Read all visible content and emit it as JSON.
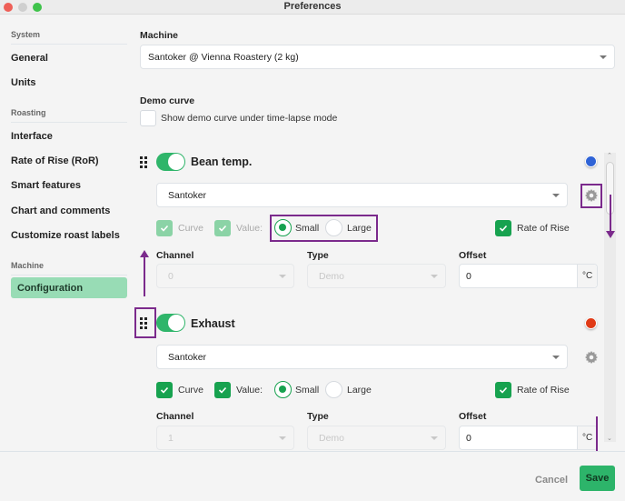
{
  "window": {
    "title": "Preferences"
  },
  "sidebar": {
    "sections": [
      {
        "label": "System",
        "items": [
          "General",
          "Units"
        ]
      },
      {
        "label": "Roasting",
        "items": [
          "Interface",
          "Rate of Rise (RoR)",
          "Smart features",
          "Chart and comments",
          "Customize roast labels"
        ]
      },
      {
        "label": "Machine",
        "items": [
          "Configuration"
        ]
      }
    ],
    "active_item": "Configuration"
  },
  "machine": {
    "label": "Machine",
    "selected": "Santoker @ Vienna Roastery (2 kg)"
  },
  "demo_curve": {
    "label": "Demo curve",
    "checkbox_label": "Show demo curve under time-lapse mode",
    "checked": false
  },
  "sensors": [
    {
      "name": "Bean temp.",
      "enabled": true,
      "color": "#2f63d6",
      "source": "Santoker",
      "curve_label": "Curve",
      "curve_checked": true,
      "value_label": "Value:",
      "value_checked": true,
      "size_options": [
        "Small",
        "Large"
      ],
      "size_selected": "Small",
      "ror_label": "Rate of Rise",
      "ror_checked": true,
      "channel_label": "Channel",
      "channel_value": "0",
      "type_label": "Type",
      "type_value": "Demo",
      "offset_label": "Offset",
      "offset_value": "0",
      "offset_unit": "°C"
    },
    {
      "name": "Exhaust",
      "enabled": true,
      "color": "#e03a16",
      "source": "Santoker",
      "curve_label": "Curve",
      "curve_checked": true,
      "value_label": "Value:",
      "value_checked": true,
      "size_options": [
        "Small",
        "Large"
      ],
      "size_selected": "Small",
      "ror_label": "Rate of Rise",
      "ror_checked": true,
      "channel_label": "Channel",
      "channel_value": "1",
      "type_label": "Type",
      "type_value": "Demo",
      "offset_label": "Offset",
      "offset_value": "0",
      "offset_unit": "°C"
    }
  ],
  "footer": {
    "cancel_label": "Cancel",
    "save_label": "Save"
  },
  "colors": {
    "accent_green": "#17a24f",
    "annotation": "#7b2a8c",
    "active_sidebar": "#98dcb5"
  }
}
